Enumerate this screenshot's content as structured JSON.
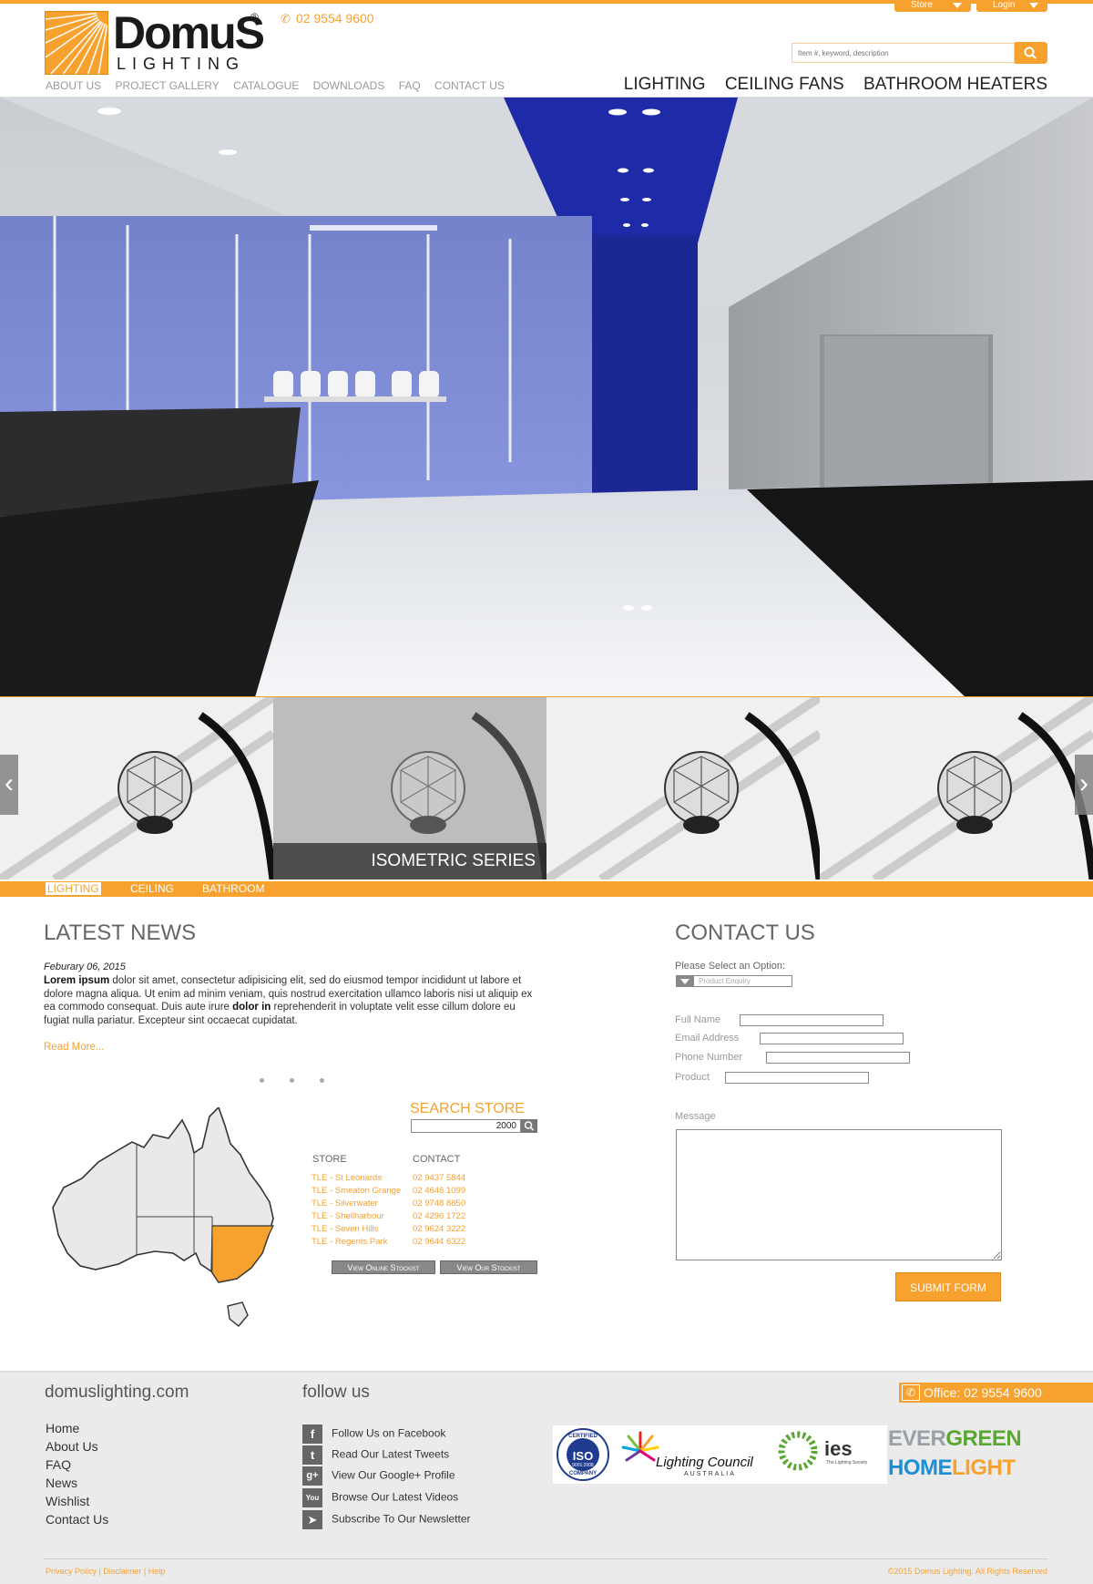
{
  "top_tabs": {
    "store": "Store",
    "login": "Login"
  },
  "brand": {
    "name": "DomuS",
    "sub": "LIGHTING",
    "reg": "®"
  },
  "header_phone": "02 9554 9600",
  "search": {
    "placeholder": "Item #, keyword, description"
  },
  "sub_nav": [
    "ABOUT US",
    "PROJECT GALLERY",
    "CATALOGUE",
    "DOWNLOADS",
    "FAQ",
    "CONTACT US"
  ],
  "main_nav": [
    "LIGHTING",
    "CEILING FANS",
    "BATHROOM HEATERS"
  ],
  "carousel": {
    "caption": "ISOMETRIC SERIES"
  },
  "category_tabs": [
    "LIGHTING",
    "CEILING",
    "BATHROOM"
  ],
  "news": {
    "title": "LATEST NEWS",
    "date": "Feburary 06, 2015",
    "lead_bold": "Lorem ipsum",
    "body_1": " dolor sit amet, consectetur adipisicing elit, sed do eiusmod tempor incididunt ut labore et dolore magna aliqua. Ut enim ad minim veniam, quis nostrud exercitation ullamco laboris nisi ut aliquip ex ea commodo consequat. Duis aute irure ",
    "mid_bold": "dolor in",
    "body_2": " reprehenderit in voluptate velit esse cillum dolore eu fugiat nulla pariatur. Excepteur sint occaecat cupidatat.",
    "read_more": "Read More..."
  },
  "store_search": {
    "title": "SEARCH STORE",
    "value": "2000",
    "col_store": "STORE",
    "col_contact": "CONTACT",
    "stores": [
      {
        "name": "TLE - St Leonards",
        "phone": "02 9437 5844"
      },
      {
        "name": "TLE - Smeaton Grange",
        "phone": "02 4646 1099"
      },
      {
        "name": "TLE - Silverwater",
        "phone": "02 9748 8850"
      },
      {
        "name": "TLE - Shellharbour",
        "phone": "02 4296 1722"
      },
      {
        "name": "TLE - Seven Hills",
        "phone": "02 9624 3222"
      },
      {
        "name": "TLE - Regents Park",
        "phone": "02 9644 6322"
      }
    ],
    "btn_online": "View Online Stockist",
    "btn_our": "View Our Stockist"
  },
  "contact": {
    "title": "CONTACT US",
    "select_label": "Please Select an Option:",
    "select_value": "Product Enquiry",
    "full_name": "Full Name",
    "email": "Email Address",
    "phone": "Phone Number",
    "product": "Product",
    "message": "Message",
    "submit": "SUBMIT FORM"
  },
  "footer": {
    "site": "domuslighting.com",
    "links": [
      "Home",
      "About Us",
      "FAQ",
      "News",
      "Wishlist",
      "Contact Us"
    ],
    "follow_title": "follow us",
    "follow": [
      {
        "icon": "f",
        "label": "Follow Us on Facebook"
      },
      {
        "icon": "t",
        "label": "Read Our Latest Tweets"
      },
      {
        "icon": "g+",
        "label": "View Our Google+ Profile"
      },
      {
        "icon": "You",
        "label": "Browse Our Latest Videos"
      },
      {
        "icon": "➤",
        "label": "Subscribe To Our Newsletter"
      }
    ],
    "office": "Office: 02 9554 9600",
    "badge_iso": "ISO",
    "badge_iso_top": "CERTIFIED",
    "badge_iso_bottom": "COMPANY",
    "badge_iso_num": "9001:2008",
    "lighting_council": "Lighting Council",
    "lighting_council_sub": "AUSTRALIA",
    "ies": "ies",
    "ies_sub": "The Lighting Society",
    "evergreen_a": "EVER",
    "evergreen_b": "GREEN",
    "homelight_a": "HOME",
    "homelight_b": "LIGHT",
    "bottom_left": "Privacy Policy | Disclaimer | Help",
    "bottom_right": "©2015 Domus Lighting. All Rights Reserved"
  },
  "colors": {
    "accent": "#f7a12e",
    "footer_bg": "#ebebeb"
  }
}
